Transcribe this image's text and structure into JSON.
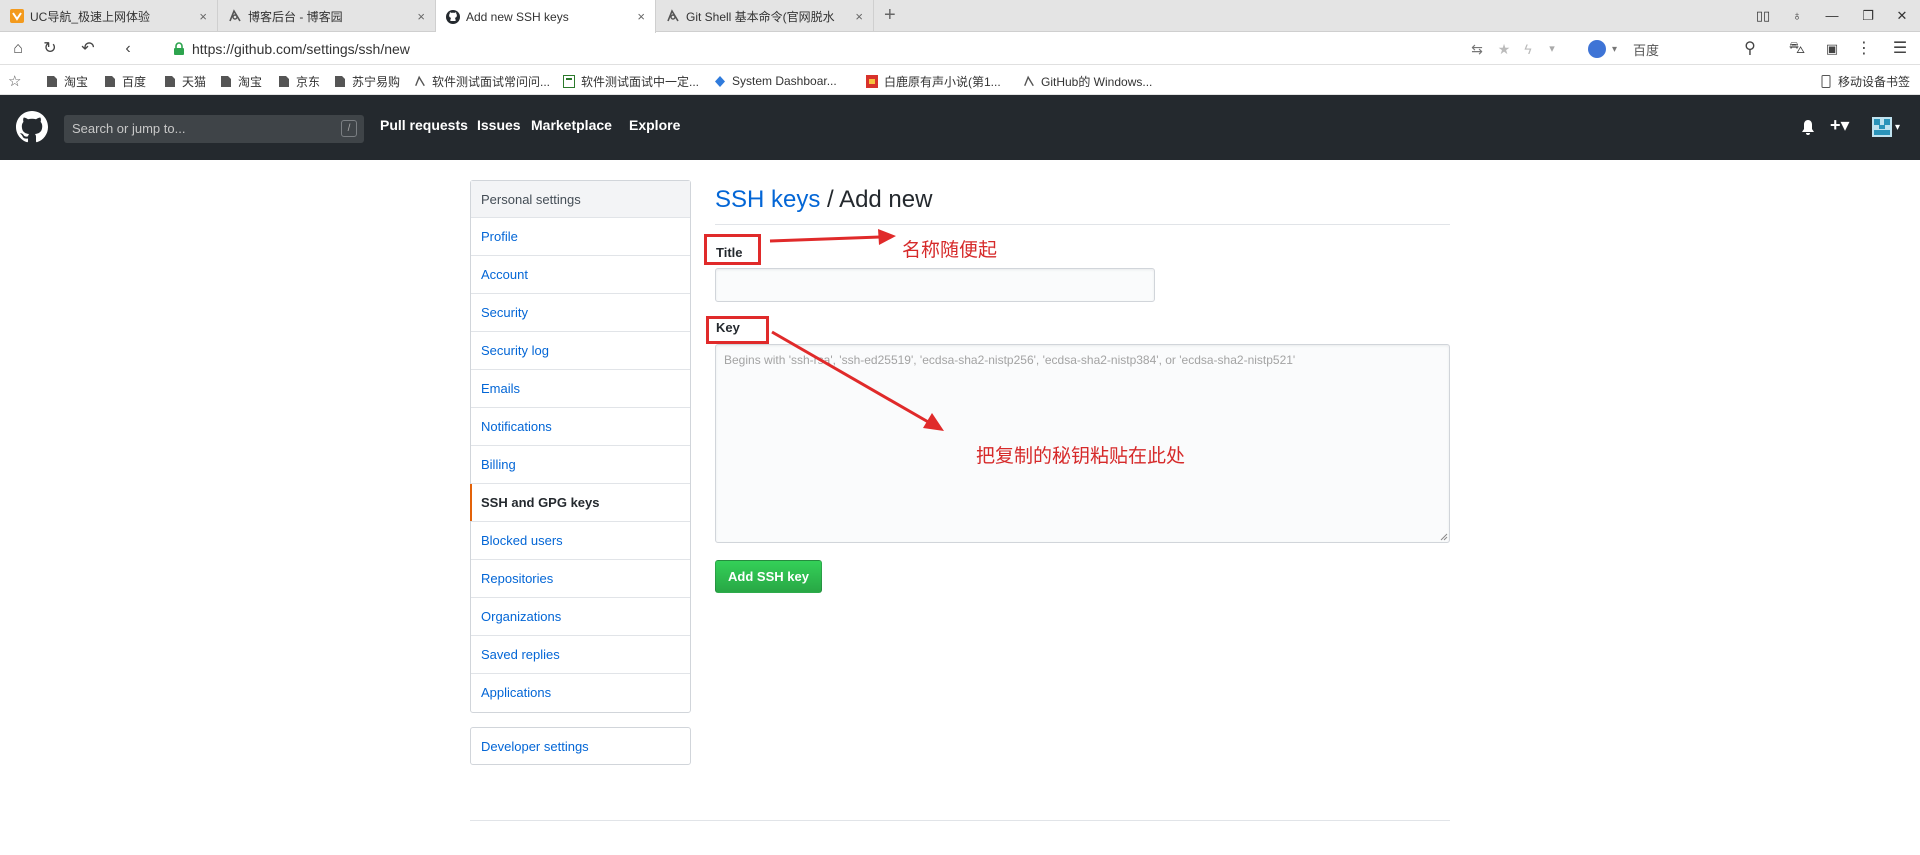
{
  "browser": {
    "tabs": [
      {
        "label": "UC导航_极速上网体验",
        "close": "×"
      },
      {
        "label": "博客后台 - 博客园",
        "close": "×"
      },
      {
        "label": "Add new SSH keys",
        "close": "×"
      },
      {
        "label": "Git Shell 基本命令(官网脱水",
        "close": "×"
      }
    ],
    "new_tab": "+",
    "window_controls": [
      "minimize-icon",
      "maximize-icon",
      "close-icon"
    ],
    "url": "https://github.com/settings/ssh/new",
    "search_engine": "百度",
    "bookmarks": [
      "淘宝",
      "百度",
      "天猫",
      "淘宝",
      "京东",
      "苏宁易购",
      "软件测试面试常问问...",
      "软件测试面试中一定...",
      "System Dashboar...",
      "白鹿原有声小说(第1...",
      "GitHub的 Windows...",
      "移动设备书签"
    ]
  },
  "github": {
    "search_placeholder": "Search or jump to...",
    "search_shortcut": "/",
    "nav": [
      "Pull requests",
      "Issues",
      "Marketplace",
      "Explore"
    ],
    "plus": "+▾"
  },
  "sidebar": {
    "heading": "Personal settings",
    "items": [
      "Profile",
      "Account",
      "Security",
      "Security log",
      "Emails",
      "Notifications",
      "Billing",
      "SSH and GPG keys",
      "Blocked users",
      "Repositories",
      "Organizations",
      "Saved replies",
      "Applications"
    ],
    "active_index": 7,
    "developer": "Developer settings"
  },
  "form": {
    "breadcrumb": "SSH keys",
    "separator": "/",
    "title": "Add new",
    "title_label": "Title",
    "title_value": "",
    "key_label": "Key",
    "key_placeholder": "Begins with 'ssh-rsa', 'ssh-ed25519', 'ecdsa-sha2-nistp256', 'ecdsa-sha2-nistp384', or 'ecdsa-sha2-nistp521'",
    "submit": "Add SSH key"
  },
  "annotations": {
    "title_note": "名称随便起",
    "key_note": "把复制的秘钥粘贴在此处"
  },
  "colors": {
    "header_bg": "#24292e",
    "link": "#0366d6",
    "button_green": "#28a745",
    "annotation_red": "#e02a2a",
    "active_indicator": "#e36209"
  }
}
